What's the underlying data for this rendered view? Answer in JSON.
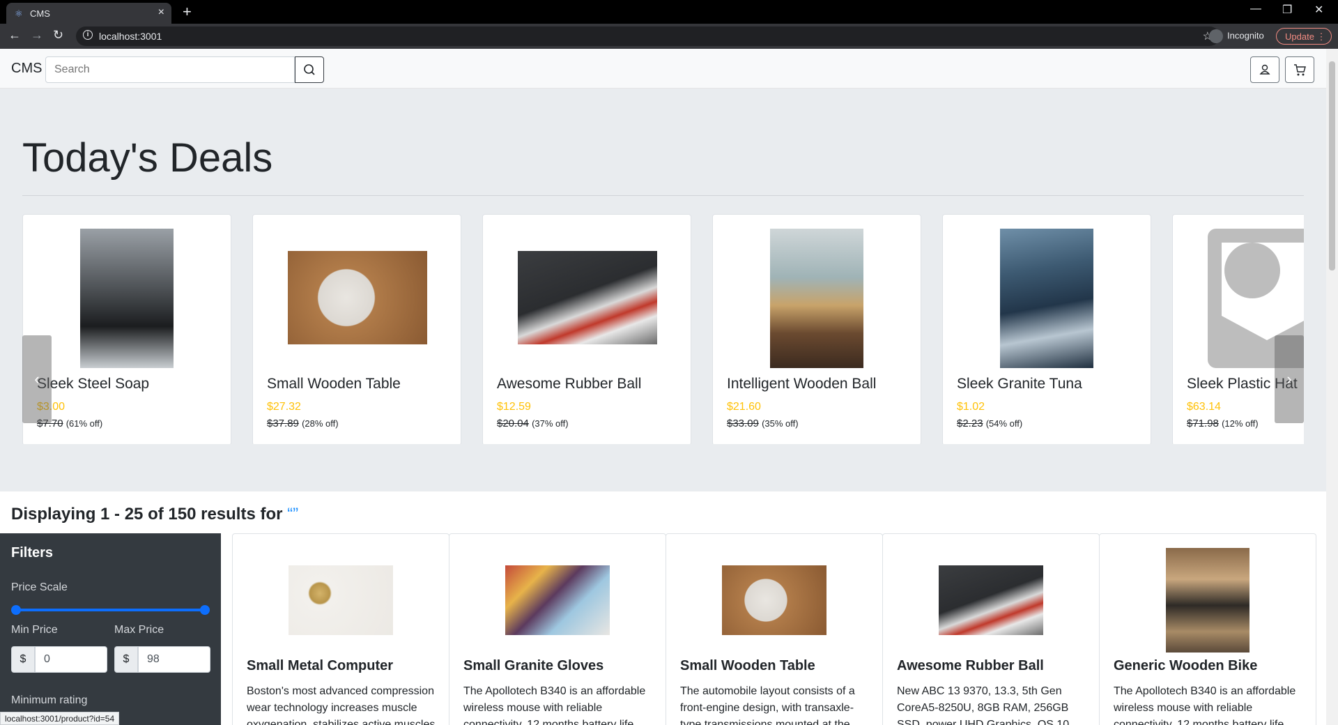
{
  "browser": {
    "tab_title": "CMS",
    "url": "localhost:3001",
    "incognito_label": "Incognito",
    "update_label": "Update"
  },
  "navbar": {
    "brand": "CMS",
    "search_placeholder": "Search"
  },
  "deals": {
    "heading": "Today's Deals",
    "items": [
      {
        "name": "Sleek Steel Soap",
        "price": "$3.00",
        "original_price": "$7.70",
        "discount": "(61% off)"
      },
      {
        "name": "Small Wooden Table",
        "price": "$27.32",
        "original_price": "$37.89",
        "discount": "(28% off)"
      },
      {
        "name": "Awesome Rubber Ball",
        "price": "$12.59",
        "original_price": "$20.04",
        "discount": "(37% off)"
      },
      {
        "name": "Intelligent Wooden Ball",
        "price": "$21.60",
        "original_price": "$33.09",
        "discount": "(35% off)"
      },
      {
        "name": "Sleek Granite Tuna",
        "price": "$1.02",
        "original_price": "$2.23",
        "discount": "(54% off)"
      },
      {
        "name": "Sleek Plastic Hat",
        "price": "$63.14",
        "original_price": "$71.98",
        "discount": "(12% off)"
      }
    ],
    "prev_label": "‹",
    "next_label": "›"
  },
  "results": {
    "text": "Displaying 1 - 25 of 150 results for",
    "query": "“”"
  },
  "filters": {
    "title": "Filters",
    "price_scale_label": "Price Scale",
    "min_price_label": "Min Price",
    "max_price_label": "Max Price",
    "currency_symbol": "$",
    "min_price_value": "0",
    "max_price_value": "98",
    "min_rating_label": "Minimum rating"
  },
  "products": [
    {
      "name": "Small Metal Computer",
      "description": "Boston's most advanced compression wear technology increases muscle oxygenation, stabilizes active muscles"
    },
    {
      "name": "Small Granite Gloves",
      "description": "The Apollotech B340 is an affordable wireless mouse with reliable connectivity, 12 months battery life"
    },
    {
      "name": "Small Wooden Table",
      "description": "The automobile layout consists of a front-engine design, with transaxle-type transmissions mounted at the"
    },
    {
      "name": "Awesome Rubber Ball",
      "description": "New ABC 13 9370, 13.3, 5th Gen CoreA5-8250U, 8GB RAM, 256GB SSD, power UHD Graphics, OS 10"
    },
    {
      "name": "Generic Wooden Bike",
      "description": "The Apollotech B340 is an affordable wireless mouse with reliable connectivity, 12 months battery life"
    }
  ],
  "status_url": "localhost:3001/product?id=54",
  "colors": {
    "price_accent": "#ffc107",
    "slider": "#0d6efd",
    "filters_bg": "#343a40",
    "query_accent": "#1e90ff"
  }
}
